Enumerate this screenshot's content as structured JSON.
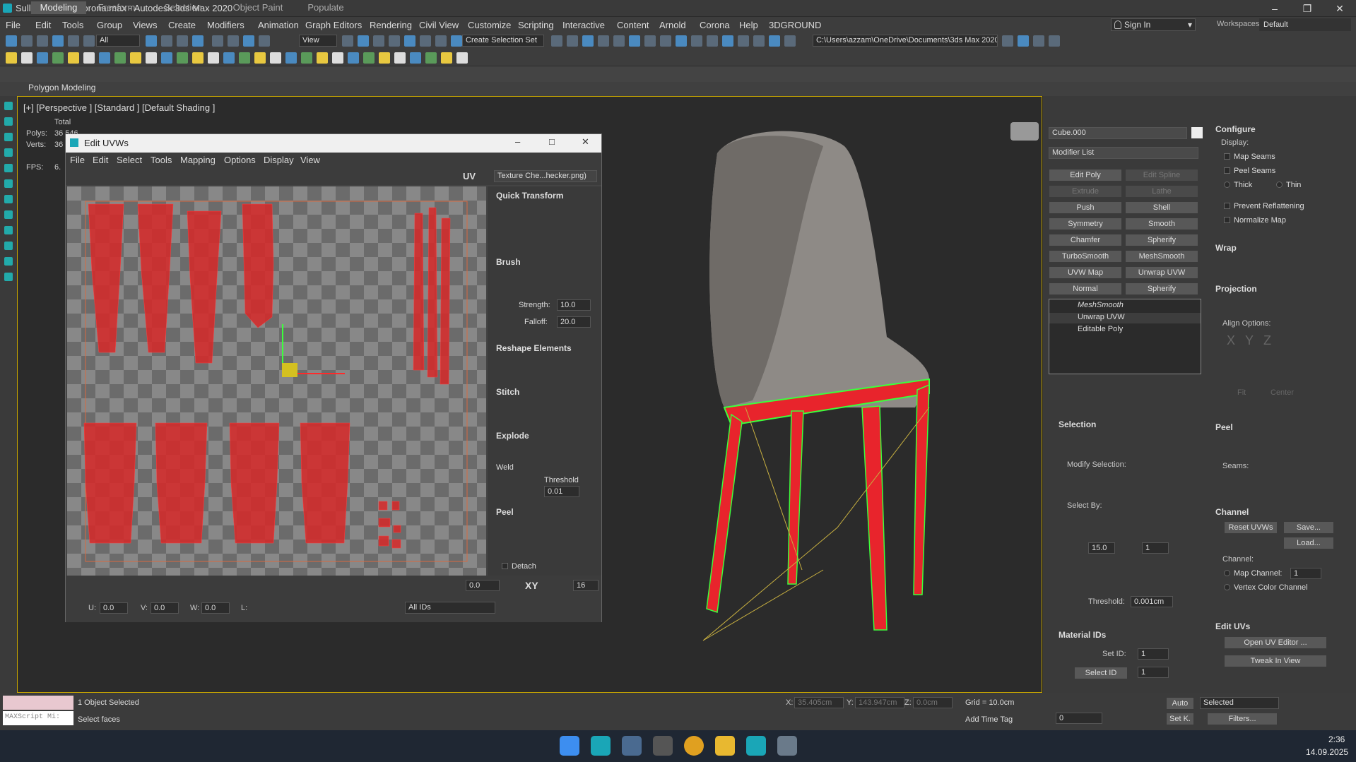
{
  "window": {
    "title": "Sullivan_2014_corona.max - Autodesk 3ds Max 2020"
  },
  "menus": [
    "File",
    "Edit",
    "Tools",
    "Group",
    "Views",
    "Create",
    "Modifiers",
    "Animation",
    "Graph Editors",
    "Rendering",
    "Civil View",
    "Customize",
    "Scripting",
    "Interactive",
    "Content",
    "Arnold",
    "Corona",
    "Help",
    "3DGROUND"
  ],
  "account": {
    "sign_in": "Sign In",
    "workspaces_label": "Workspaces:",
    "workspace": "Default"
  },
  "toolbar": {
    "filter": "All",
    "ref_coord": "View",
    "selection_set": "Create Selection Set",
    "path": "C:\\Users\\azzam\\OneDrive\\Documents\\3ds Max 2020"
  },
  "ribbon": {
    "tabs": [
      "Modeling",
      "Freeform",
      "Selection",
      "Object Paint",
      "Populate"
    ],
    "sub": "Polygon Modeling"
  },
  "viewport": {
    "label": "[+] [Perspective ] [Standard ] [Default Shading ]",
    "total": "Total",
    "polys_label": "Polys:",
    "polys": "36 546",
    "verts_label": "Verts:",
    "verts": "36",
    "fps_label": "FPS:",
    "fps": "6."
  },
  "uvw": {
    "title": "Edit UVWs",
    "menus": [
      "File",
      "Edit",
      "Select",
      "Tools",
      "Mapping",
      "Options",
      "Display",
      "View"
    ],
    "uv_label": "UV",
    "texture": "Texture Che...hecker.png)",
    "panel": {
      "quick": "Quick Transform",
      "brush": "Brush",
      "strength_label": "Strength:",
      "strength": "10.0",
      "falloff_label": "Falloff:",
      "falloff": "20.0",
      "reshape": "Reshape Elements",
      "stitch": "Stitch",
      "explode": "Explode",
      "weld": "Weld",
      "threshold_label": "Threshold",
      "threshold": "0.01",
      "peel": "Peel",
      "detach": "Detach"
    },
    "bottom": {
      "angle": "0.0",
      "xy": "XY",
      "grid": "16",
      "u_label": "U:",
      "u": "0.0",
      "v_label": "V:",
      "v": "0.0",
      "w_label": "W:",
      "w": "0.0",
      "l_label": "L:",
      "ids": "All IDs"
    }
  },
  "cmd": {
    "object": "Cube.000",
    "modifier_list": "Modifier List",
    "mods": [
      "Edit Poly",
      "Edit Spline",
      "Extrude",
      "Lathe",
      "Push",
      "Shell",
      "Symmetry",
      "Smooth",
      "Chamfer",
      "Spherify",
      "TurboSmooth",
      "MeshSmooth",
      "UVW Map",
      "Unwrap UVW",
      "Normal",
      "Spherify"
    ],
    "stack": [
      "MeshSmooth",
      "Unwrap UVW",
      "Editable Poly"
    ],
    "selection": "Selection",
    "modify_selection": "Modify Selection:",
    "select_by": "Select By:",
    "angle": "15.0",
    "count": "1",
    "threshold_label": "Threshold:",
    "threshold": "0.001cm",
    "material_ids": "Material IDs",
    "set_id_label": "Set ID:",
    "set_id": "1",
    "select_id": "Select ID",
    "select_id_val": "1",
    "configure": "Configure",
    "display": "Display:",
    "map_seams": "Map Seams",
    "peel_seams": "Peel Seams",
    "thick": "Thick",
    "thin": "Thin",
    "prevent": "Prevent Reflattening",
    "normalize": "Normalize Map",
    "wrap": "Wrap",
    "projection": "Projection",
    "align": "Align Options:",
    "align_axes": [
      "X",
      "Y",
      "Z"
    ],
    "fit": "Fit",
    "center": "Center",
    "peel": "Peel",
    "seams": "Seams:",
    "channel": "Channel",
    "reset": "Reset UVWs",
    "save": "Save...",
    "load": "Load...",
    "channel_label": "Channel:",
    "map_channel": "Map Channel:",
    "map_channel_val": "1",
    "vertex_color": "Vertex Color Channel",
    "edit_uvs": "Edit UVs",
    "open_uv": "Open UV Editor ...",
    "tweak": "Tweak In View"
  },
  "status": {
    "script": "MAXScript Mi:",
    "selected": "1 Object Selected",
    "prompt": "Select faces",
    "x_label": "X:",
    "x": "35.405cm",
    "y_label": "Y:",
    "y": "143.947cm",
    "z_label": "Z:",
    "z": "0.0cm",
    "grid": "Grid = 10.0cm",
    "add_time": "Add Time Tag",
    "auto": "Auto",
    "set_k": "Set K.",
    "sel_filter": "Selected",
    "filters": "Filters...",
    "frame": "0"
  },
  "taskbar": {
    "time": "2:36",
    "date": "14.09.2025"
  },
  "colors": {
    "accent": "#e8242c",
    "seam": "#3cff3c",
    "uvcheck": "#888888"
  }
}
